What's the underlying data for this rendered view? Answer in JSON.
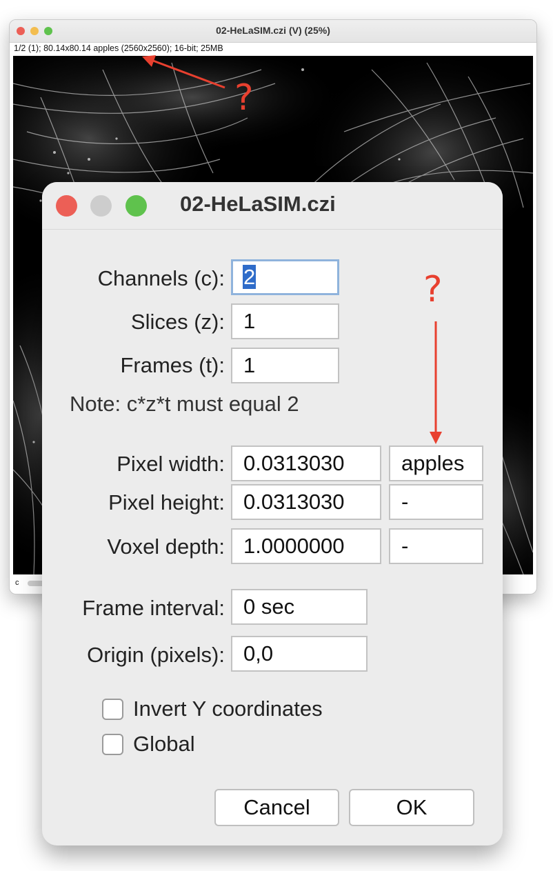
{
  "image_window": {
    "title": "02-HeLaSIM.czi (V) (25%)",
    "info": "1/2 (1); 80.14x80.14 apples (2560x2560); 16-bit; 25MB",
    "channel_label": "c"
  },
  "dialog": {
    "title": "02-HeLaSIM.czi",
    "channels": {
      "label": "Channels (c):",
      "value": "2"
    },
    "slices": {
      "label": "Slices (z):",
      "value": "1"
    },
    "frames": {
      "label": "Frames (t):",
      "value": "1"
    },
    "note": "Note: c*z*t must equal 2",
    "pixel_width": {
      "label": "Pixel width:",
      "value": "0.0313030",
      "unit": "apples"
    },
    "pixel_height": {
      "label": "Pixel height:",
      "value": "0.0313030",
      "unit": "-"
    },
    "voxel_depth": {
      "label": "Voxel depth:",
      "value": "1.0000000",
      "unit": "-"
    },
    "frame_interval": {
      "label": "Frame interval:",
      "value": "0 sec"
    },
    "origin": {
      "label": "Origin (pixels):",
      "value": "0,0"
    },
    "invert_y": {
      "label": "Invert Y coordinates",
      "checked": false
    },
    "global": {
      "label": "Global",
      "checked": false
    },
    "cancel_label": "Cancel",
    "ok_label": "OK"
  },
  "annotations": {
    "mark_top": "?",
    "mark_right": "?"
  },
  "colors": {
    "close": "#ec5f56",
    "minimize": "#f3bd4f",
    "zoom": "#5fc24d",
    "disabled": "#cdcdcd",
    "annotation": "#e8402f",
    "selection": "#2f6cc9"
  }
}
